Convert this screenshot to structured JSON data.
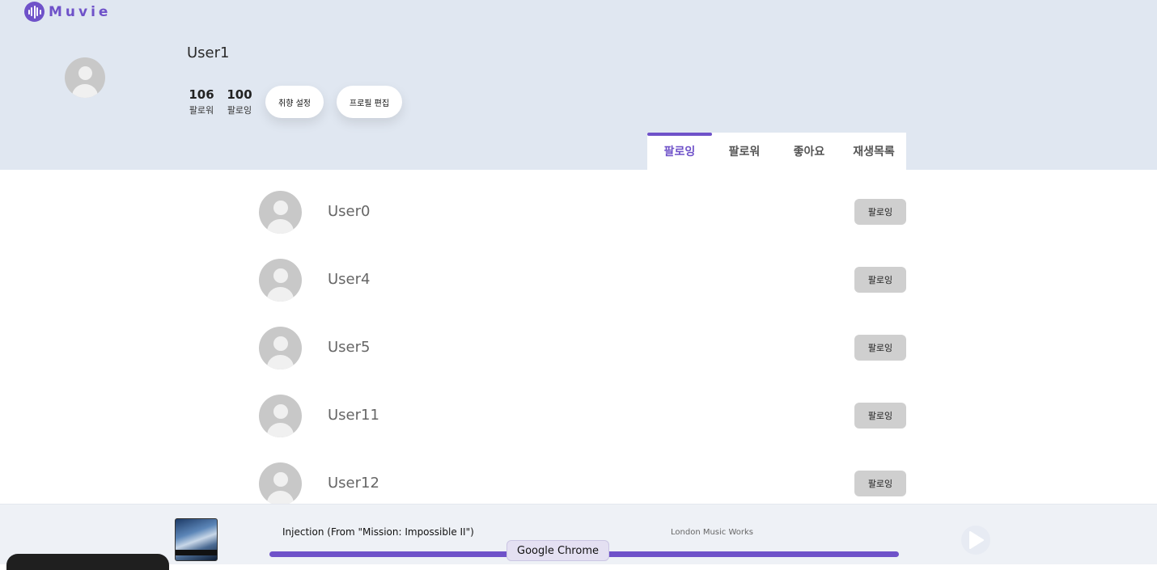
{
  "app": {
    "logo_text": "Muvie",
    "accent": "#6f52c9"
  },
  "profile": {
    "username": "User1",
    "followers_count": "106",
    "followers_label": "팔로워",
    "following_count": "100",
    "following_label": "팔로잉",
    "taste_button": "취향 설정",
    "edit_button": "프로필 편집"
  },
  "tabs": [
    {
      "label": "팔로잉",
      "active": true
    },
    {
      "label": "팔로워",
      "active": false
    },
    {
      "label": "좋아요",
      "active": false
    },
    {
      "label": "재생목록",
      "active": false
    }
  ],
  "users": [
    {
      "name": "User0",
      "button": "팔로잉"
    },
    {
      "name": "User4",
      "button": "팔로잉"
    },
    {
      "name": "User5",
      "button": "팔로잉"
    },
    {
      "name": "User11",
      "button": "팔로잉"
    },
    {
      "name": "User12",
      "button": "팔로잉"
    }
  ],
  "player": {
    "title": "Injection (From \"Mission: Impossible II\")",
    "artist": "London Music Works",
    "progress": 1.0,
    "play_icon": "play-icon"
  },
  "tooltip": "Google Chrome"
}
